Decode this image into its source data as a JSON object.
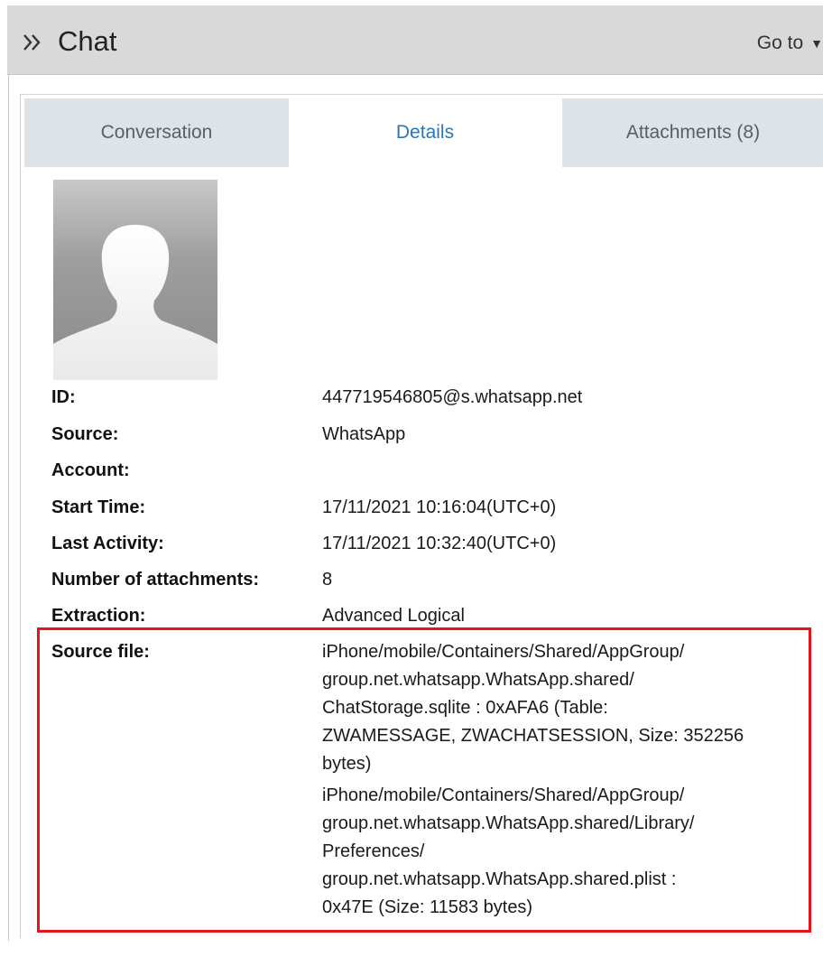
{
  "header": {
    "title": "Chat",
    "goto_label": "Go to",
    "collapse_icon": "double-chevron-right-icon",
    "caret_icon": "chevron-down-icon"
  },
  "tabs": [
    {
      "label": "Conversation",
      "active": false
    },
    {
      "label": "Details",
      "active": true
    },
    {
      "label": "Attachments (8)",
      "active": false
    }
  ],
  "avatar": {
    "icon": "person-silhouette-icon"
  },
  "details": {
    "id": {
      "label": "ID:",
      "value": "447719546805@s.whatsapp.net"
    },
    "source": {
      "label": "Source:",
      "value": "WhatsApp"
    },
    "account": {
      "label": "Account:",
      "value": ""
    },
    "start_time": {
      "label": "Start Time:",
      "value": "17/11/2021 10:16:04(UTC+0)"
    },
    "last_activity": {
      "label": "Last Activity:",
      "value": "17/11/2021 10:32:40(UTC+0)"
    },
    "num_attachments": {
      "label": "Number of attachments:",
      "value": "8"
    },
    "extraction": {
      "label": "Extraction:",
      "value": "Advanced Logical"
    },
    "source_file": {
      "label": "Source file:",
      "entries": [
        {
          "lines": [
            "iPhone/mobile/Containers/Shared/AppGroup/",
            "group.net.whatsapp.WhatsApp.shared/",
            "ChatStorage.sqlite : 0xAFA6 (Table:",
            "ZWAMESSAGE, ZWACHATSESSION, Size: 352256",
            "bytes)"
          ]
        },
        {
          "lines": [
            "iPhone/mobile/Containers/Shared/AppGroup/",
            "group.net.whatsapp.WhatsApp.shared/Library/",
            "Preferences/",
            "group.net.whatsapp.WhatsApp.shared.plist :",
            "0x47E (Size: 11583 bytes)"
          ]
        }
      ]
    }
  },
  "colors": {
    "highlight_border": "#e8141c",
    "active_tab_text": "#2e75b6",
    "inactive_tab_bg": "#dee3e8",
    "header_bg": "#d9d9d9"
  }
}
